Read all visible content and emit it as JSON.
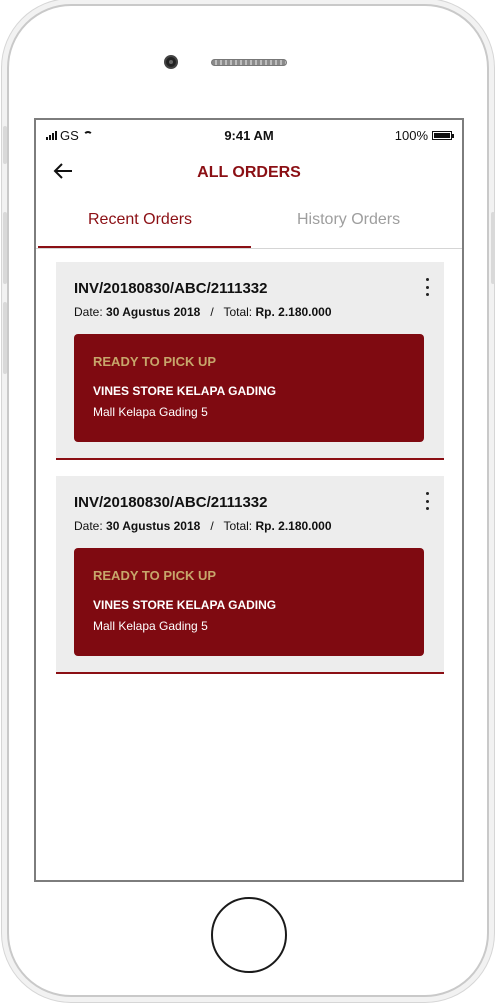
{
  "status_bar": {
    "carrier": "GS",
    "time": "9:41 AM",
    "battery": "100%"
  },
  "header": {
    "title": "ALL ORDERS"
  },
  "tabs": [
    {
      "label": "Recent Orders",
      "active": true
    },
    {
      "label": "History Orders",
      "active": false
    }
  ],
  "orders": [
    {
      "invoice": "INV/20180830/ABC/2111332",
      "date_label": "Date:",
      "date": "30 Agustus 2018",
      "separator": "/",
      "total_label": "Total:",
      "total": "Rp. 2.180.000",
      "status": "READY TO PICK UP",
      "store": "VINES STORE KELAPA GADING",
      "location": "Mall Kelapa Gading 5"
    },
    {
      "invoice": "INV/20180830/ABC/2111332",
      "date_label": "Date:",
      "date": "30 Agustus 2018",
      "separator": "/",
      "total_label": "Total:",
      "total": "Rp. 2.180.000",
      "status": "READY TO PICK UP",
      "store": "VINES STORE KELAPA GADING",
      "location": "Mall Kelapa Gading 5"
    }
  ],
  "colors": {
    "accent": "#8b0f14",
    "card": "#7f0a11",
    "status_text": "#c7a66b"
  }
}
